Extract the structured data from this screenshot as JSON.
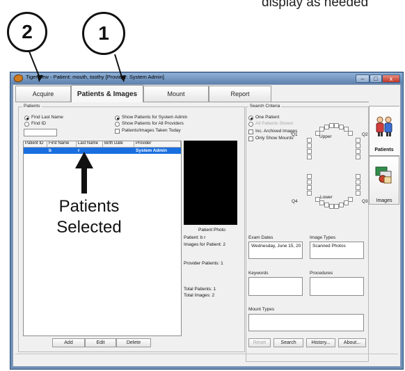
{
  "annotations": {
    "top_caption": "display as needed",
    "callout_left": "2",
    "callout_right": "1",
    "selection_note_line1": "Patients",
    "selection_note_line2": "Selected"
  },
  "window": {
    "title": "TigerView - Patient: mouth, toothy [Provider: System Admin]",
    "controls": {
      "minimize": "–",
      "maximize": "□",
      "close": "x"
    }
  },
  "tabs": [
    "Acquire",
    "Patients & Images",
    "Mount",
    "Report"
  ],
  "patients": {
    "group_title": "Patients",
    "find_last_name": "Find Last Name",
    "find_id": "Find ID",
    "show_system_admin": "Show Patients for System Admin",
    "show_all_providers": "Show Patients for All Providers",
    "taken_today": "Patients/Images Taken Today",
    "columns": [
      "Patient ID",
      "First Name",
      "Last Name",
      "Birth Date",
      "Provider"
    ],
    "rows": [
      {
        "patient_id": "",
        "first_name": "b",
        "last_name": "r",
        "birth_date": "",
        "provider": "System Admin"
      }
    ],
    "buttons": {
      "add": "Add",
      "edit": "Edit",
      "delete": "Delete"
    }
  },
  "photo_panel": {
    "caption": "Patient Photo",
    "patient": "Patient: b r",
    "images_for_patient": "Images for Patient: 2",
    "provider_patients": "Provider Patients: 1",
    "total_patients": "Total Patients: 1",
    "total_images": "Total Images: 2"
  },
  "search": {
    "group_title": "Search Criteria",
    "one_patient": "One Patient",
    "all_patients": "All Patients Shown",
    "inc_archived": "Inc. Archived Images",
    "only_mounts": "Only Show Mounts",
    "quadrants": {
      "q1": "Q1",
      "q2": "Q2",
      "q3": "Q3",
      "q4": "Q4",
      "upper": "Upper",
      "lower": "Lower"
    },
    "exam_dates_label": "Exam Dates",
    "exam_dates_value": "Wednesday, June 15, 20",
    "image_types_label": "Image Types",
    "image_types_value": "Scanned Photos",
    "keywords_label": "Keywords",
    "procedures_label": "Procedures",
    "mount_types_label": "Mount Types",
    "buttons": {
      "reset": "Reset",
      "search": "Search",
      "history": "History...",
      "about": "About..."
    }
  },
  "side_tabs": {
    "patients": "Patients",
    "images": "Images"
  },
  "colors": {
    "selection": "#1a6fe0",
    "title_bar": "#6d8fb8",
    "close_button": "#c0382a"
  }
}
